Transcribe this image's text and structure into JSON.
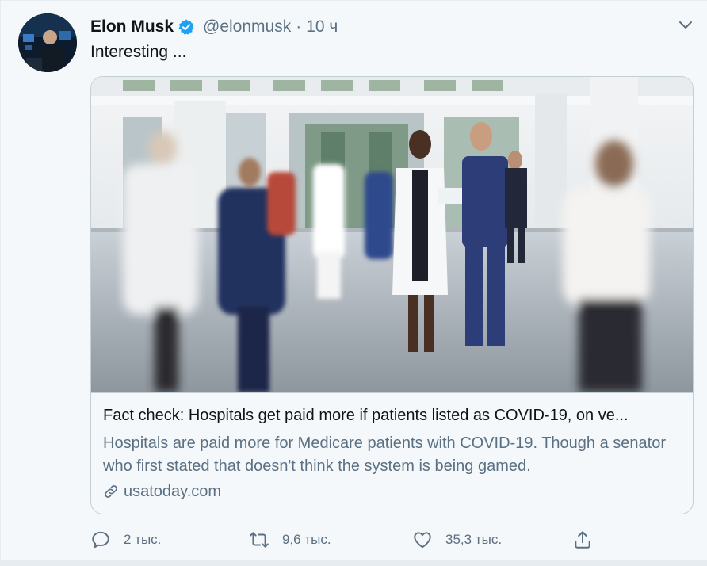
{
  "tweet": {
    "author_name": "Elon Musk",
    "handle": "@elonmusk",
    "separator": "·",
    "time": "10 ч",
    "text": "Interesting ...",
    "verified": true
  },
  "card": {
    "title": "Fact check: Hospitals get paid more if patients listed as COVID-19, on ve...",
    "description": "Hospitals are paid more for Medicare patients with COVID-19. Though a senator who first stated that doesn't think the system is being gamed.",
    "domain": "usatoday.com",
    "image_icon": "hospital-lobby-photo"
  },
  "actions": {
    "reply_count": "2 тыс.",
    "retweet_count": "9,6 тыс.",
    "like_count": "35,3 тыс.",
    "icons": [
      "reply-icon",
      "retweet-icon",
      "like-icon",
      "share-icon"
    ]
  },
  "colors": {
    "background": "#f5f8fa",
    "text_primary": "#0f1419",
    "text_secondary": "#5b7083",
    "verified_blue": "#1da1f2",
    "border": "#c4cfd6"
  }
}
